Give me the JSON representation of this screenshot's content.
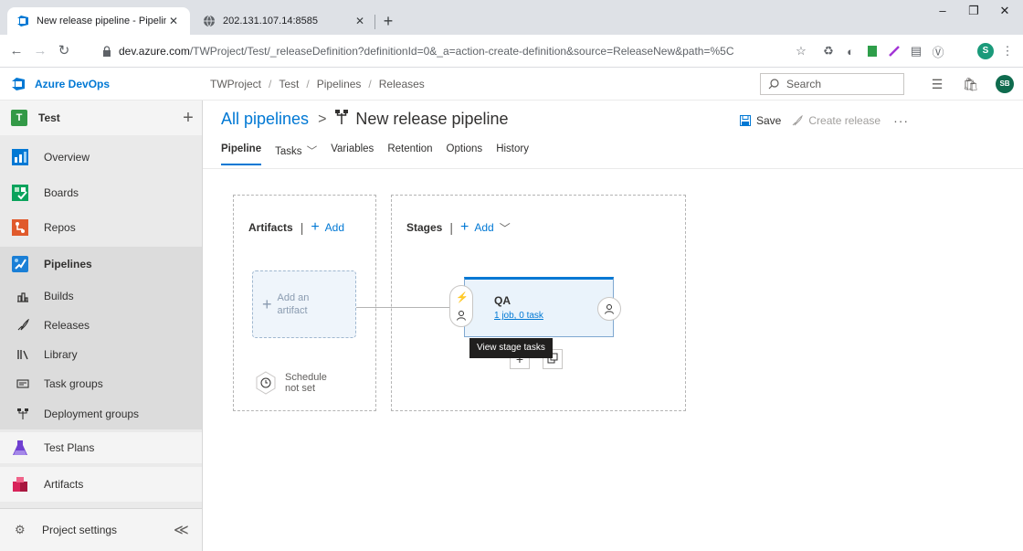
{
  "browser": {
    "tabs": [
      {
        "title": "New release pipeline - Pipelines",
        "close": "✕"
      },
      {
        "title": "202.131.107.14:8585",
        "close": "✕"
      }
    ],
    "new_tab": "+",
    "window_controls": [
      "–",
      "❐",
      "✕"
    ],
    "url_host": "dev.azure.com",
    "url_path": "/TWProject/Test/_releaseDefinition?definitionId=0&_a=action-create-definition&source=ReleaseNew&path=%5C",
    "profile_initial": "S"
  },
  "header": {
    "product": "Azure DevOps",
    "breadcrumbs": [
      "TWProject",
      "Test",
      "Pipelines",
      "Releases"
    ],
    "breadcrumb_sep": "/",
    "search_placeholder": "Search",
    "user_initials": "SB"
  },
  "sidebar": {
    "project_initial": "T",
    "project_name": "Test",
    "add": "+",
    "items": [
      {
        "label": "Overview",
        "icon": "overview-icon"
      },
      {
        "label": "Boards",
        "icon": "boards-icon"
      },
      {
        "label": "Repos",
        "icon": "repos-icon"
      },
      {
        "label": "Pipelines",
        "icon": "pipelines-icon"
      },
      {
        "label": "Builds",
        "icon": "builds-icon"
      },
      {
        "label": "Releases",
        "icon": "releases-icon"
      },
      {
        "label": "Library",
        "icon": "library-icon"
      },
      {
        "label": "Task groups",
        "icon": "task-groups-icon"
      },
      {
        "label": "Deployment groups",
        "icon": "deployment-groups-icon"
      },
      {
        "label": "Test Plans",
        "icon": "test-plans-icon"
      },
      {
        "label": "Artifacts",
        "icon": "artifacts-icon"
      }
    ],
    "footer_label": "Project settings",
    "collapse": "≪"
  },
  "page": {
    "parent": "All pipelines",
    "chevron": ">",
    "title": "New release pipeline",
    "save": "Save",
    "create_release": "Create release",
    "more": "···",
    "tabs": [
      "Pipeline",
      "Tasks",
      "Variables",
      "Retention",
      "Options",
      "History"
    ],
    "active_tab": "Pipeline"
  },
  "canvas": {
    "artifacts_title": "Artifacts",
    "stages_title": "Stages",
    "add": "Add",
    "add_artifact_line1": "Add an",
    "add_artifact_line2": "artifact",
    "schedule_line1": "Schedule",
    "schedule_line2": "not set",
    "stage": {
      "name": "QA",
      "link": "1 job, 0 task"
    },
    "tooltip": "View stage tasks",
    "stage_add": "+"
  },
  "colors": {
    "accent": "#0078d4",
    "project_badge": "#339947",
    "sidebar_bg": "#eaeaea"
  }
}
